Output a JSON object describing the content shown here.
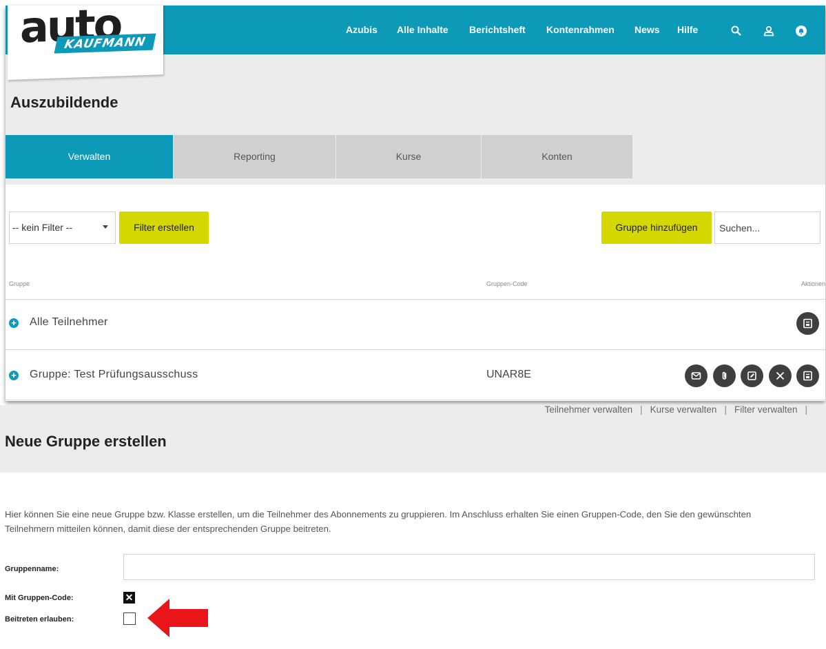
{
  "logo": {
    "word": "auto",
    "subtitle": "KAUFMANN"
  },
  "nav": {
    "links": [
      "Azubis",
      "Alle Inhalte",
      "Berichtsheft",
      "Kontenrahmen",
      "News",
      "Hilfe"
    ],
    "icons": [
      "search-icon",
      "user-icon",
      "notification-icon"
    ]
  },
  "page": {
    "title": "Auszubildende"
  },
  "tabs": [
    "Verwalten",
    "Reporting",
    "Kurse",
    "Konten"
  ],
  "toolbar": {
    "filter_value": "-- kein Filter --",
    "create_filter_label": "Filter erstellen",
    "add_group_label": "Gruppe hinzufügen",
    "search_placeholder": "Suchen..."
  },
  "table": {
    "headers": {
      "group": "Gruppe",
      "code": "Gruppen-Code",
      "actions": "Aktionen"
    },
    "rows": [
      {
        "name": "Alle Teilnehmer",
        "code": "",
        "actions": [
          "export-icon"
        ]
      },
      {
        "name": "Gruppe: Test Prüfungsausschuss",
        "code": "UNAR8E",
        "actions": [
          "mail-icon",
          "attach-icon",
          "edit-icon",
          "close-icon",
          "export-icon"
        ]
      }
    ]
  },
  "form": {
    "title": "Neue Gruppe erstellen",
    "sublinks": [
      "Teilnehmer verwalten",
      "Kurse verwalten",
      "Filter verwalten"
    ],
    "intro": "Hier können Sie eine neue Gruppe bzw. Klasse erstellen, um die Teilnehmer des Abonnements zu gruppieren. Im Anschluss erhalten Sie einen Gruppen-Code, den Sie den gewünschten Teilnehmern mitteilen können, damit diese der entsprechenden Gruppe beitreten.",
    "name_label": "Gruppenname:",
    "name_value": "",
    "code_label": "Mit Gruppen-Code:",
    "code_checked": true,
    "join_label": "Beitreten erlauben:",
    "join_checked": false
  },
  "colors": {
    "accent": "#0d99b8",
    "button": "#d5d800",
    "action": "#3f3f3f",
    "arrow": "#e8161a"
  }
}
